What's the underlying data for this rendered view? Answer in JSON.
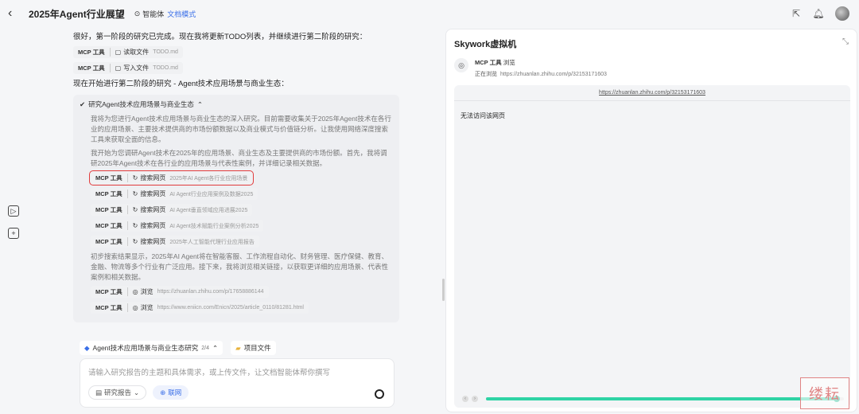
{
  "header": {
    "title": "2025年Agent行业展望",
    "agent_label": "智能体",
    "mode_label": "文档模式"
  },
  "chat": {
    "intro": "很好，第一阶段的研究已完成。现在我将更新TODO列表，并继续进行第二阶段的研究：",
    "tool_calls_1": [
      {
        "mcp": "MCP 工具",
        "action": "读取文件",
        "arg": "TODO.md"
      },
      {
        "mcp": "MCP 工具",
        "action": "写入文件",
        "arg": "TODO.md"
      }
    ],
    "stage2_title": "现在开始进行第二阶段的研究 - Agent技术应用场景与商业生态：",
    "thinking_header": "研究Agent技术应用场景与商业生态",
    "thinking_p1": "我将为您进行Agent技术应用场景与商业生态的深入研究。目前需要收集关于2025年Agent技术在各行业的应用场景、主要技术提供商的市场份额数据以及商业模式与价值链分析。让我使用网络深度搜索工具来获取全面的信息。",
    "thinking_p2": "我开始为您调研Agent技术在2025年的应用场景、商业生态及主要提供商的市场份额。首先，我将调研2025年Agent技术在各行业的应用场景与代表性案例，并详细记录相关数据。",
    "search_calls": [
      {
        "mcp": "MCP 工具",
        "action": "搜索网页",
        "arg": "2025年AI Agent各行业应用场景"
      },
      {
        "mcp": "MCP 工具",
        "action": "搜索网页",
        "arg": "AI Agent行业应用案例及数据2025"
      },
      {
        "mcp": "MCP 工具",
        "action": "搜索网页",
        "arg": "AI Agent垂直领域应用进展2025"
      },
      {
        "mcp": "MCP 工具",
        "action": "搜索网页",
        "arg": "AI Agent技术赋能行业案例分析2025"
      },
      {
        "mcp": "MCP 工具",
        "action": "搜索网页",
        "arg": "2025年人工智能代理行业应用报告"
      }
    ],
    "thinking_p3": "初步搜索结果显示，2025年AI Agent将在智能客服、工作流程自动化、财务管理、医疗保健、教育、金融、物流等多个行业有广泛应用。接下来，我将浏览相关链接，以获取更详细的应用场景、代表性案例和相关数据。",
    "browse_calls": [
      {
        "mcp": "MCP 工具",
        "action": "浏览",
        "arg": "https://zhuanlan.zhihu.com/p/17658886144"
      },
      {
        "mcp": "MCP 工具",
        "action": "浏览",
        "arg": "https://www.eniicn.com/Enicn/2025/article_0110/81281.html"
      }
    ]
  },
  "steps_bar": {
    "label": "Agent技术应用场景与商业生态研究",
    "count": "2/4",
    "project_files": "项目文件"
  },
  "input": {
    "placeholder": "请输入研究报告的主题和具体需求，或上传文件，让文档智能体帮你撰写",
    "report_button": "研究报告",
    "web_button": "联网"
  },
  "panel": {
    "title": "Skywork虚拟机",
    "tool_label": "MCP 工具",
    "tool_action": "浏览",
    "status": "正在浏览",
    "status_url": "https://zhuanlan.zhihu.com/p/32153171603",
    "viewer_url": "https://zhuanlan.zhihu.com/p/32153171603",
    "viewer_message": "无法访问该网页",
    "progress": 0.98
  },
  "watermark": "缕耘",
  "colors": {
    "accent": "#3a6fe8",
    "highlight": "#e23d3d",
    "progress": "#2ed3a5"
  }
}
